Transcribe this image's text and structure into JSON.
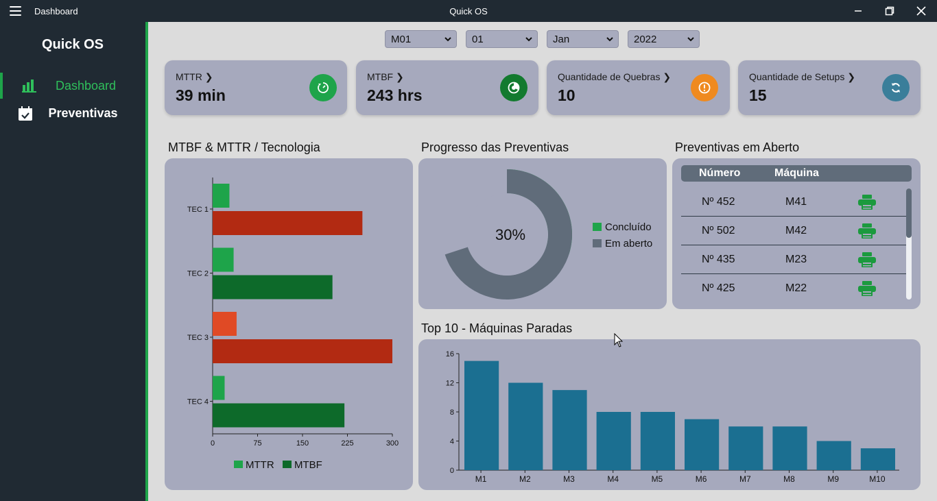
{
  "window": {
    "page_name": "Dashboard",
    "app_title": "Quick OS",
    "minimize_icon": "minimize-icon",
    "restore_icon": "restore-icon",
    "close_icon": "close-icon"
  },
  "sidebar": {
    "brand": "Quick OS",
    "items": [
      {
        "label": "Dashboard",
        "icon": "bar-chart-icon",
        "active": true
      },
      {
        "label": "Preventivas",
        "icon": "calendar-check-icon",
        "active": false
      }
    ]
  },
  "filters": [
    {
      "value": "M01"
    },
    {
      "value": "01"
    },
    {
      "value": "Jan"
    },
    {
      "value": "2022"
    }
  ],
  "kpis": [
    {
      "label": "MTTR",
      "value": "39 min",
      "icon": "timer-icon",
      "color": "#1ea44a"
    },
    {
      "label": "MTBF",
      "value": "243 hrs",
      "icon": "gauge-icon",
      "color": "#137a2f"
    },
    {
      "label": "Quantidade de Quebras",
      "value": "10",
      "icon": "alert-circle-icon",
      "color": "#ef8a1f"
    },
    {
      "label": "Quantidade de Setups",
      "value": "15",
      "icon": "sync-icon",
      "color": "#3a7e9a"
    }
  ],
  "sections": {
    "mtbf_mttr": "MTBF & MTTR / Tecnologia",
    "progress": "Progresso das Preventivas",
    "open": "Preventivas em Aberto",
    "top10": "Top 10 - Máquinas Paradas"
  },
  "open_table": {
    "headers": [
      "Número",
      "Máquina"
    ],
    "rows": [
      {
        "numero": "Nº 452",
        "maquina": "M41"
      },
      {
        "numero": "Nº 502",
        "maquina": "M42"
      },
      {
        "numero": "Nº 435",
        "maquina": "M23"
      },
      {
        "numero": "Nº 425",
        "maquina": "M22"
      }
    ],
    "print_icon": "printer-icon",
    "print_color": "#1b9a3e"
  },
  "chart_data": [
    {
      "type": "bar",
      "orientation": "horizontal",
      "categories": [
        "TEC 1",
        "TEC 2",
        "TEC 3",
        "TEC 4"
      ],
      "series": [
        {
          "name": "MTTR",
          "values": [
            28,
            35,
            40,
            20
          ],
          "colors": [
            "#1ea44a",
            "#1ea44a",
            "#e04a25",
            "#1ea44a"
          ]
        },
        {
          "name": "MTBF",
          "values": [
            250,
            200,
            300,
            220
          ],
          "colors": [
            "#b22a12",
            "#0d6a2a",
            "#b22a12",
            "#0d6a2a"
          ]
        }
      ],
      "xticks": [
        "0",
        "75",
        "150",
        "225",
        "300"
      ],
      "xlim": [
        0,
        300
      ],
      "legend": "bottom",
      "legend_colors": [
        "#1ea44a",
        "#0d6a2a"
      ],
      "grid": false
    },
    {
      "type": "pie",
      "style": "donut",
      "center_label": "30%",
      "slices": [
        {
          "label": "Concluído",
          "value": 30,
          "color": "#1ea44a"
        },
        {
          "label": "Em aberto",
          "value": 70,
          "color": "#606c7a"
        }
      ],
      "legend": "right"
    },
    {
      "type": "bar",
      "categories": [
        "M1",
        "M2",
        "M3",
        "M4",
        "M5",
        "M6",
        "M7",
        "M8",
        "M9",
        "M10"
      ],
      "values": [
        15,
        12,
        11,
        8,
        8,
        7,
        6,
        6,
        4,
        3
      ],
      "yticks": [
        "0",
        "4",
        "8",
        "12",
        "16"
      ],
      "ylim": [
        0,
        16
      ],
      "color": "#1b6f91",
      "grid": false
    }
  ]
}
